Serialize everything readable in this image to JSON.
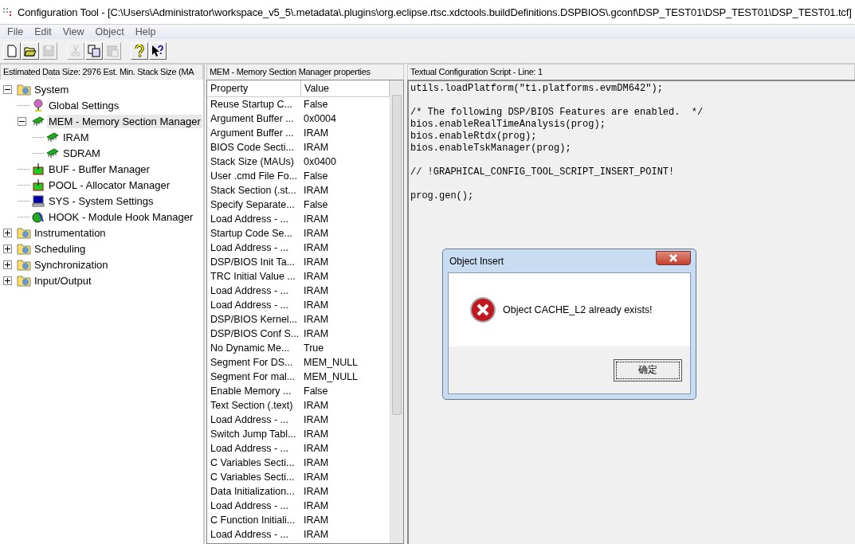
{
  "window": {
    "title": "Configuration Tool - [C:\\Users\\Administrator\\workspace_v5_5\\.metadata\\.plugins\\org.eclipse.rtsc.xdctools.buildDefinitions.DSPBIOS\\.gconf\\DSP_TEST01\\DSP_TEST01\\DSP_TEST01.tcf]"
  },
  "menu": [
    "File",
    "Edit",
    "View",
    "Object",
    "Help"
  ],
  "toolbar": [
    {
      "kind": "new",
      "disabled": false
    },
    {
      "kind": "open",
      "disabled": false
    },
    {
      "kind": "save",
      "disabled": true
    },
    {
      "kind": "cut",
      "disabled": true
    },
    {
      "kind": "copy",
      "disabled": false
    },
    {
      "kind": "paste",
      "disabled": true
    },
    {
      "kind": "help",
      "disabled": false
    },
    {
      "kind": "context-help",
      "disabled": false
    }
  ],
  "tree": {
    "header": "Estimated Data Size: 2976   Est. Min. Stack Size (MA",
    "items": [
      {
        "label": "System",
        "kind": "folder",
        "expanded": true,
        "selected": false,
        "children": [
          {
            "label": "Global Settings",
            "kind": "globe",
            "selected": false
          },
          {
            "label": "MEM - Memory Section Manager",
            "kind": "chip",
            "expanded": true,
            "selected": true,
            "children": [
              {
                "label": "IRAM",
                "kind": "chip",
                "selected": false
              },
              {
                "label": "SDRAM",
                "kind": "chip",
                "selected": false
              }
            ]
          },
          {
            "label": "BUF - Buffer Manager",
            "kind": "buffer",
            "selected": false
          },
          {
            "label": "POOL - Allocator Manager",
            "kind": "buffer",
            "selected": false
          },
          {
            "label": "SYS - System Settings",
            "kind": "monitor",
            "selected": false
          },
          {
            "label": "HOOK - Module Hook Manager",
            "kind": "hook",
            "selected": false
          }
        ]
      },
      {
        "label": "Instrumentation",
        "kind": "folder",
        "expanded": false,
        "selected": false
      },
      {
        "label": "Scheduling",
        "kind": "folder",
        "expanded": false,
        "selected": false
      },
      {
        "label": "Synchronization",
        "kind": "folder",
        "expanded": false,
        "selected": false
      },
      {
        "label": "Input/Output",
        "kind": "folder",
        "expanded": false,
        "selected": false
      }
    ]
  },
  "properties": {
    "header": "MEM - Memory Section Manager properties",
    "columns": [
      "Property",
      "Value"
    ],
    "rows": [
      [
        "Reuse Startup C...",
        "False"
      ],
      [
        "Argument Buffer ...",
        "0x0004"
      ],
      [
        "Argument Buffer ...",
        "IRAM"
      ],
      [
        "BIOS Code Secti...",
        "IRAM"
      ],
      [
        "Stack Size (MAUs)",
        "0x0400"
      ],
      [
        "User .cmd File Fo...",
        "False"
      ],
      [
        "Stack Section (.st...",
        "IRAM"
      ],
      [
        "Specify Separate...",
        "False"
      ],
      [
        "Load Address - ...",
        "IRAM"
      ],
      [
        "Startup Code Se...",
        "IRAM"
      ],
      [
        "Load Address - ...",
        "IRAM"
      ],
      [
        "DSP/BIOS Init Ta...",
        "IRAM"
      ],
      [
        "TRC Initial Value ...",
        "IRAM"
      ],
      [
        "Load Address - ...",
        "IRAM"
      ],
      [
        "Load Address - ...",
        "IRAM"
      ],
      [
        "DSP/BIOS Kernel...",
        "IRAM"
      ],
      [
        "DSP/BIOS Conf S...",
        "IRAM"
      ],
      [
        "No Dynamic Me...",
        "True"
      ],
      [
        "Segment For DS...",
        "MEM_NULL"
      ],
      [
        "Segment For mal...",
        "MEM_NULL"
      ],
      [
        "Enable Memory ...",
        "False"
      ],
      [
        "Text Section (.text)",
        "IRAM"
      ],
      [
        "Load Address - ...",
        "IRAM"
      ],
      [
        "Switch Jump Tabl...",
        "IRAM"
      ],
      [
        "Load Address - ...",
        "IRAM"
      ],
      [
        "C Variables Secti...",
        "IRAM"
      ],
      [
        "C Variables Secti...",
        "IRAM"
      ],
      [
        "Data Initialization...",
        "IRAM"
      ],
      [
        "Load Address - ...",
        "IRAM"
      ],
      [
        "C Function Initiali...",
        "IRAM"
      ],
      [
        "Load Address - ...",
        "IRAM"
      ]
    ]
  },
  "script": {
    "header": "Textual Configuration Script - Line: 1",
    "text": "utils.loadPlatform(\"ti.platforms.evmDM642\");\n\n/* The following DSP/BIOS Features are enabled.  */\nbios.enableRealTimeAnalysis(prog);\nbios.enableRtdx(prog);\nbios.enableTskManager(prog);\n\n// !GRAPHICAL_CONFIG_TOOL_SCRIPT_INSERT_POINT!\n\nprog.gen();"
  },
  "dialog": {
    "title": "Object Insert",
    "message": "Object CACHE_L2 already exists!",
    "button": "确定"
  }
}
